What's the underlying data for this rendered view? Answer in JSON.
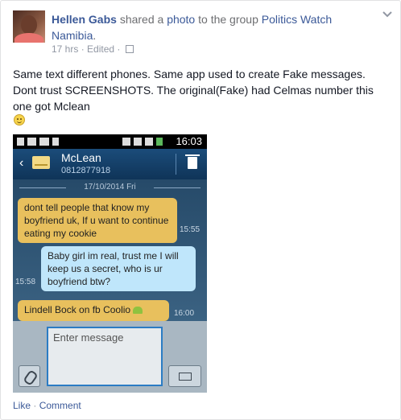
{
  "author": "Hellen Gabs",
  "action_text": "shared a",
  "photo_link": "photo",
  "to_text": "to the group",
  "group_name": "Politics Watch Namibia",
  "group_suffix": ".",
  "time_text": "17 hrs",
  "edited_text": "Edited",
  "post_text": "Same text different phones. Same app used to create Fake messages. Dont trust SCREENSHOTS. The original(Fake) had Celmas number this one got Mclean",
  "phone": {
    "status_time": "16:03",
    "contact_name": "McLean",
    "contact_number": "0812877918",
    "date_divider": "17/10/2014 Fri",
    "messages": [
      {
        "text": "dont tell people that know my boyfriend uk, If u want to continue eating my cookie",
        "time": "15:55"
      },
      {
        "text": "Baby girl im real, trust me I will keep us a secret, who is ur boyfriend btw?",
        "time": "15:58"
      },
      {
        "text": "Lindell Bock on fb Coolio",
        "time": "16:00"
      }
    ],
    "compose_placeholder": "Enter message"
  },
  "actions": {
    "like": "Like",
    "separator": "·",
    "comment": "Comment"
  },
  "colors": {
    "link": "#3b5998",
    "muted": "#9197a3"
  }
}
